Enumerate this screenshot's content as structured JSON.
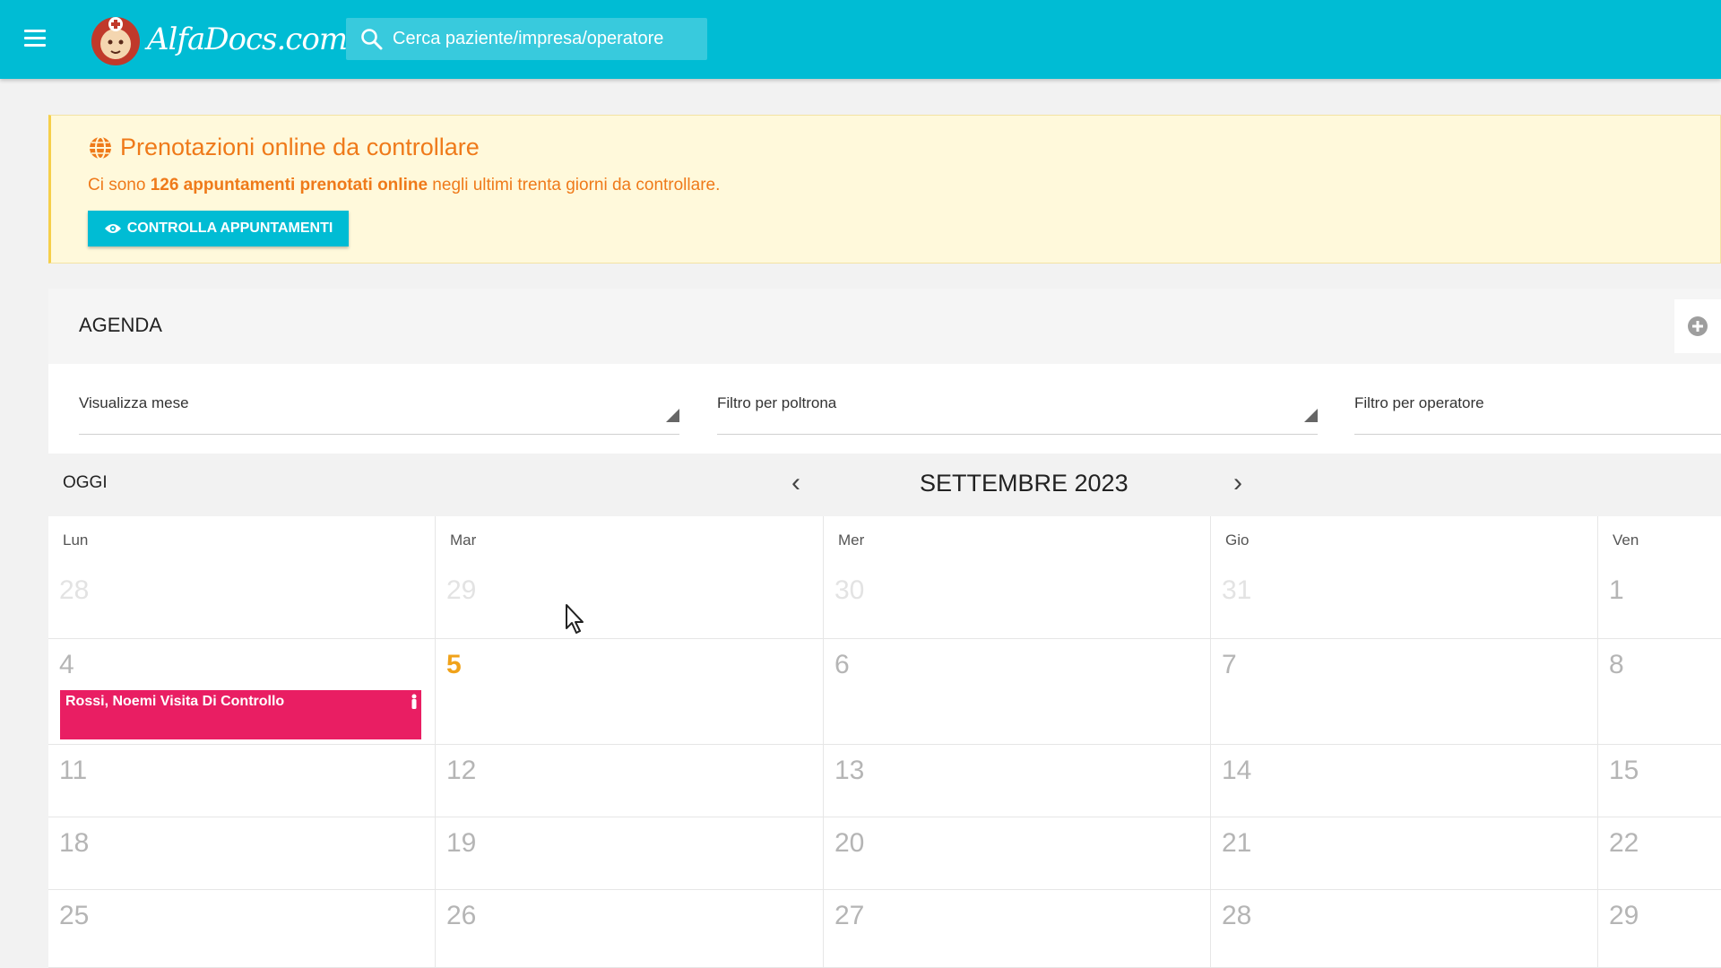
{
  "header": {
    "logo_text": "AlfaDocs.com",
    "search_placeholder": "Cerca paziente/impresa/operatore"
  },
  "banner": {
    "title": "Prenotazioni online da controllare",
    "text_before": "Ci sono ",
    "text_bold": "126 appuntamenti prenotati online",
    "text_after": " negli ultimi trenta giorni da controllare.",
    "button_label": "CONTROLLA APPUNTAMENTI"
  },
  "agenda": {
    "title": "AGENDA",
    "filters": {
      "view": "Visualizza mese",
      "chair": "Filtro per poltrona",
      "operator": "Filtro per operatore"
    },
    "today_label": "OGGI",
    "month_label": "SETTEMBRE 2023",
    "weekdays": [
      "Lun",
      "Mar",
      "Mer",
      "Gio",
      "Ven"
    ],
    "weeks": [
      [
        "28",
        "29",
        "30",
        "31",
        "1"
      ],
      [
        "4",
        "5",
        "6",
        "7",
        "8"
      ],
      [
        "11",
        "12",
        "13",
        "14",
        "15"
      ],
      [
        "18",
        "19",
        "20",
        "21",
        "22"
      ],
      [
        "25",
        "26",
        "27",
        "28",
        "29"
      ]
    ],
    "event": {
      "name": "Rossi, Noemi",
      "title": " Visita Di Controllo"
    }
  },
  "colors": {
    "primary": "#00bcd4",
    "banner_text": "#ef7a1a",
    "event": "#e91e63",
    "today": "#f0a21a"
  }
}
